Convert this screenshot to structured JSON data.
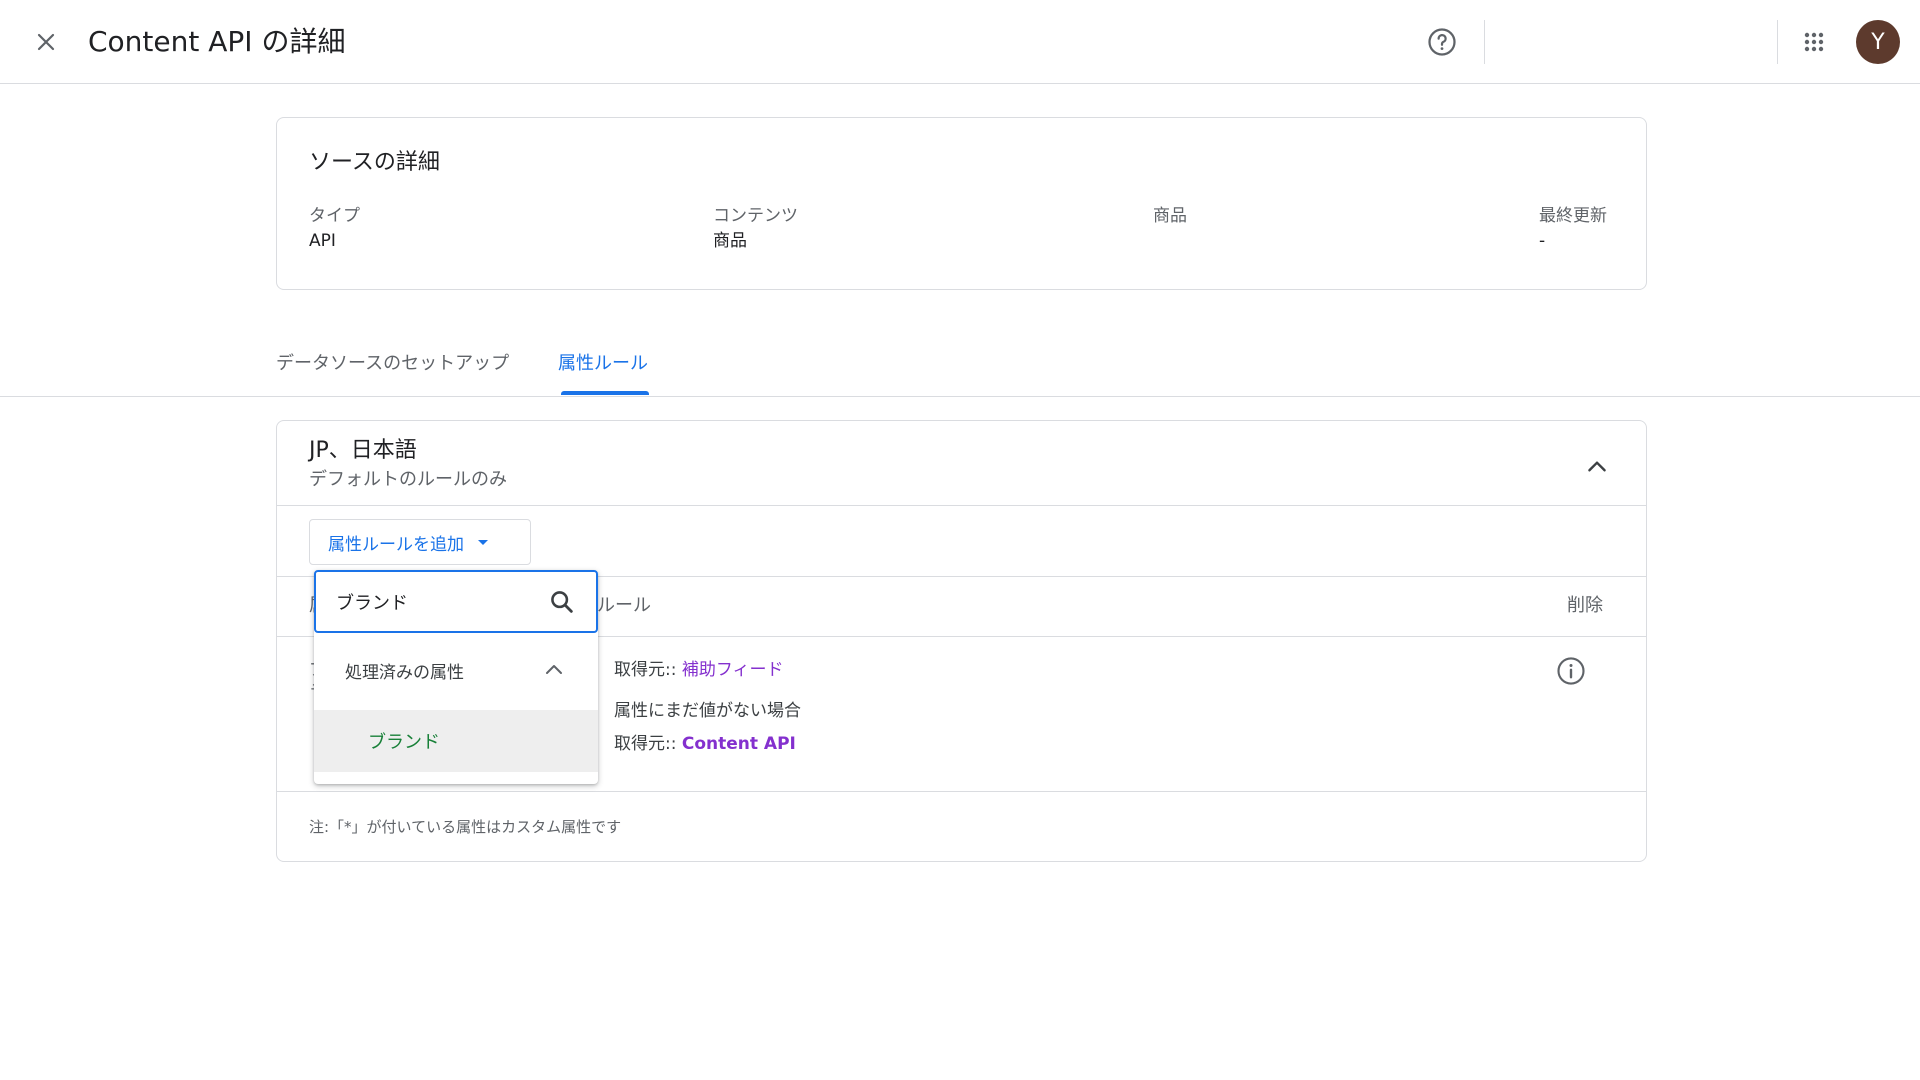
{
  "header": {
    "title": "Content API の詳細",
    "icons": {
      "close": "close-icon",
      "help": "help-circle-icon",
      "apps": "apps-grid-icon"
    },
    "avatar_letter": "Y"
  },
  "source_details": {
    "title": "ソースの詳細",
    "fields": [
      {
        "label": "タイプ",
        "value": "API"
      },
      {
        "label": "コンテンツ",
        "value": "商品"
      },
      {
        "label": "商品",
        "value": ""
      },
      {
        "label": "最終更新",
        "value": "-"
      }
    ]
  },
  "tabs": [
    {
      "label": "データソースのセットアップ",
      "active": false
    },
    {
      "label": "属性ルール",
      "active": true
    }
  ],
  "rules_section": {
    "title": "JP、日本語",
    "subtitle": "デフォルトのルールのみ",
    "add_button_label": "属性ルールを追加",
    "columns": {
      "attribute_partial": "属",
      "rule_partial": "ルール",
      "delete": "削除"
    },
    "row": {
      "line1_prefix": "取得元::",
      "line1_link": "補助フィード",
      "line2": "属性にまだ値がない場合",
      "line3_prefix": "取得元::",
      "line3_link": "Content API",
      "hidden_left_1": "ブ",
      "hidden_left_2": "ラ"
    },
    "footnote": "注:「*」が付いている属性はカスタム属性です"
  },
  "dropdown": {
    "search_value": "ブランド",
    "group_label": "処理済みの属性",
    "options": [
      {
        "label": "ブランド",
        "highlighted": true
      }
    ]
  },
  "colors": {
    "accent": "#1a73e8",
    "link_purple": "#8430ce",
    "option_green": "#188038",
    "avatar_bg": "#5d3a2d"
  }
}
